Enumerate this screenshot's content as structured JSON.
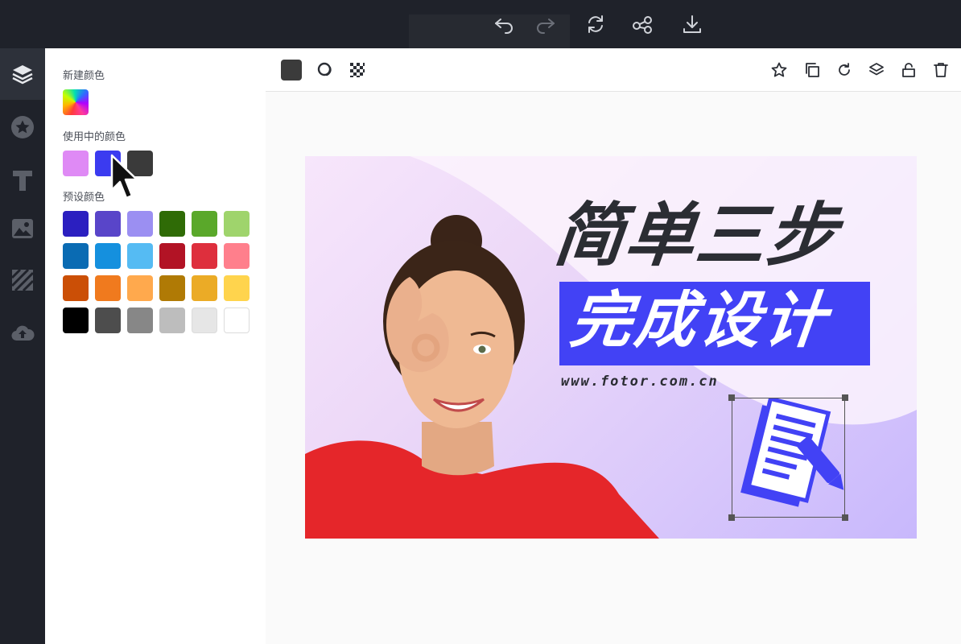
{
  "app": {
    "toolbar_icons": [
      "undo-icon",
      "redo-icon",
      "refresh-icon",
      "share-icon",
      "download-icon"
    ],
    "colors": {
      "topbar": "#1f222a",
      "accent": "#4242f5"
    }
  },
  "sidebar": {
    "items": [
      {
        "icon": "layers-icon",
        "active": true
      },
      {
        "icon": "star-icon"
      },
      {
        "icon": "text-icon"
      },
      {
        "icon": "image-icon"
      },
      {
        "icon": "background-icon"
      },
      {
        "icon": "upload-icon"
      }
    ]
  },
  "panel": {
    "new_color_label": "新建颜色",
    "in_use_label": "使用中的颜色",
    "preset_label": "预设颜色",
    "in_use_colors": [
      "#df8af5",
      "#3b3bf0",
      "#3a3a3a"
    ],
    "preset_colors": [
      [
        "#2b1fc0",
        "#5945c9",
        "#9b8ff2",
        "#2f6b06",
        "#5aa82a",
        "#9fd46c"
      ],
      [
        "#0a6bb3",
        "#1590de",
        "#55bbf3",
        "#b21325",
        "#de2f3d",
        "#ff7f8c"
      ],
      [
        "#cb4f06",
        "#f07a1e",
        "#ffa94d",
        "#b07a05",
        "#ebab26",
        "#ffd44d"
      ],
      [
        "#000000",
        "#4d4d4d",
        "#878787",
        "#bdbdbd",
        "#e6e6e6",
        "#ffffff"
      ]
    ]
  },
  "canvas_toolbar": {
    "left_icons": [
      "fill-color-square",
      "blend-icon",
      "transparency-icon"
    ],
    "right_icons": [
      "favorite-icon",
      "duplicate-icon",
      "rotate-icon",
      "layer-order-icon",
      "lock-icon",
      "delete-icon"
    ]
  },
  "design": {
    "title": "简单三步",
    "subtitle": "完成设计",
    "url": "www.fotor.com.cn",
    "colors": {
      "subtitle_bg": "#4242f5",
      "title": "#2b2d33"
    }
  }
}
